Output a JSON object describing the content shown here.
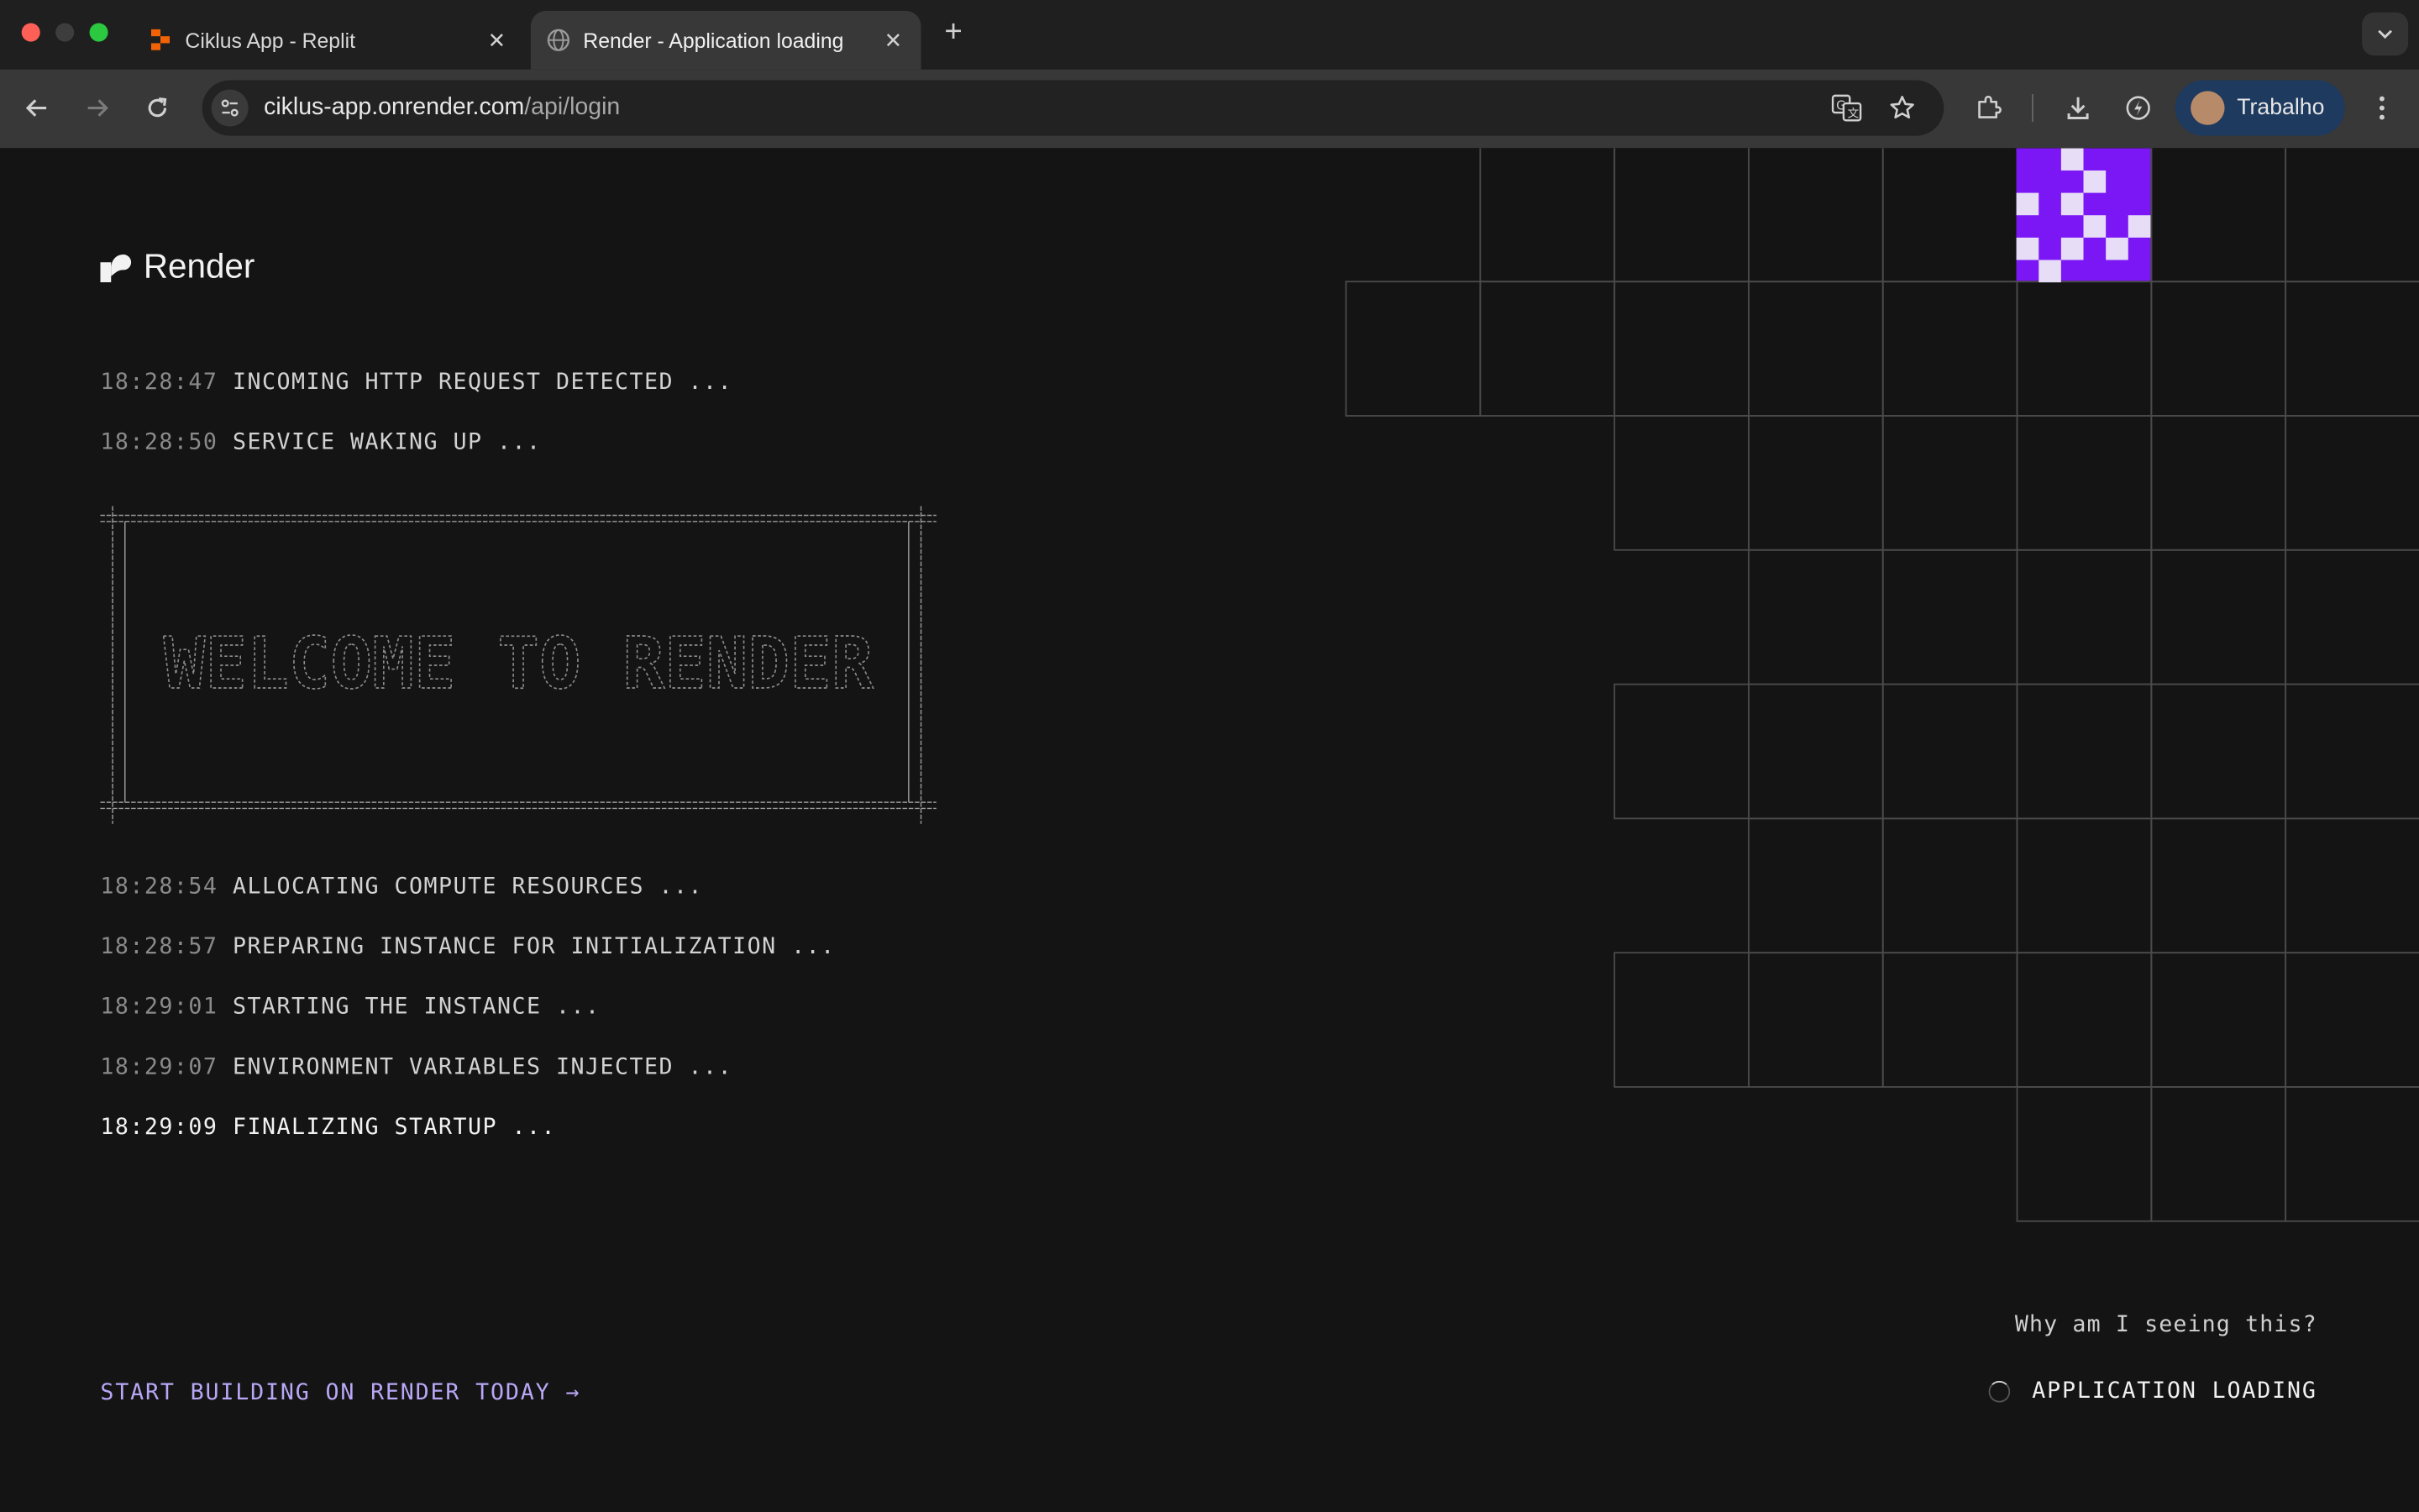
{
  "browser": {
    "tabs": [
      {
        "title": "Ciklus App - Replit",
        "active": false,
        "icon": "replit-icon"
      },
      {
        "title": "Render - Application loading",
        "active": true,
        "icon": "globe-icon"
      }
    ],
    "new_tab_icon": "plus-icon",
    "url_host": "ciklus-app.onrender.com",
    "url_path": "/api/login",
    "profile_name": "Trabalho"
  },
  "page": {
    "brand": "Render",
    "logs_before": [
      {
        "time": "18:28:47",
        "message": "INCOMING HTTP REQUEST DETECTED ..."
      },
      {
        "time": "18:28:50",
        "message": "SERVICE WAKING UP ..."
      }
    ],
    "banner_text": "WELCOME TO RENDER",
    "logs_after": [
      {
        "time": "18:28:54",
        "message": "ALLOCATING COMPUTE RESOURCES ..."
      },
      {
        "time": "18:28:57",
        "message": "PREPARING INSTANCE FOR INITIALIZATION ..."
      },
      {
        "time": "18:29:01",
        "message": "STARTING THE INSTANCE ..."
      },
      {
        "time": "18:29:07",
        "message": "ENVIRONMENT VARIABLES INJECTED ..."
      },
      {
        "time": "18:29:09",
        "message": "FINALIZING STARTUP ..."
      }
    ],
    "cta": "START BUILDING ON RENDER TODAY →",
    "why": "Why am I seeing this?",
    "status": "APPLICATION LOADING",
    "colors": {
      "background": "#141414",
      "accent_purple": "#7b17f5",
      "cta": "#b9a7f6",
      "grid_line": "#4a4a4a"
    }
  }
}
